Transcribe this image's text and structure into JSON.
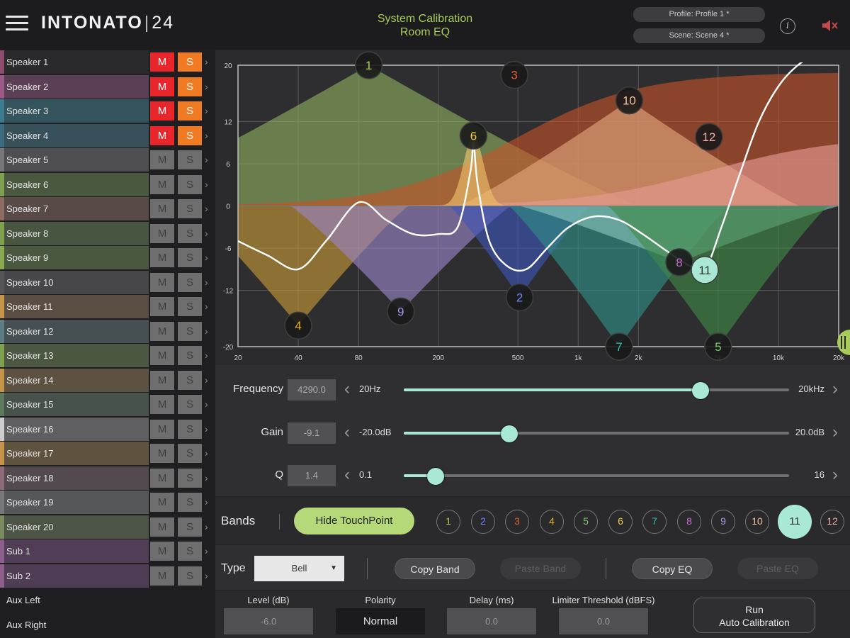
{
  "app": {
    "logo_main": "INTONATO",
    "logo_sep": "|",
    "logo_num": "24",
    "title_line1": "System Calibration",
    "title_line2": "Room EQ",
    "profile": "Profile: Profile 1 *",
    "scene": "Scene: Scene 4 *",
    "info_icon": "info-icon",
    "mute_icon": "speaker-muted-icon"
  },
  "sidebar": {
    "speakers": [
      {
        "label": "Speaker 1",
        "color": "#8b4f6d",
        "bg": "#2a2a2d",
        "m": "M",
        "s": "S",
        "mute_on": true,
        "solo_on": true
      },
      {
        "label": "Speaker 2",
        "color": "#9b5b86",
        "bg": "#5b3f55",
        "m": "M",
        "s": "S",
        "mute_on": true,
        "solo_on": true
      },
      {
        "label": "Speaker 3",
        "color": "#3c7c8e",
        "bg": "#35555e",
        "m": "M",
        "s": "S",
        "mute_on": true,
        "solo_on": true
      },
      {
        "label": "Speaker 4",
        "color": "#3c6c7e",
        "bg": "#37505a",
        "m": "M",
        "s": "S",
        "mute_on": true,
        "solo_on": true
      },
      {
        "label": "Speaker 5",
        "color": "#777777",
        "bg": "#4f4f52",
        "m": "M",
        "s": "S",
        "mute_on": false,
        "solo_on": false
      },
      {
        "label": "Speaker 6",
        "color": "#7ea04f",
        "bg": "#4a5840",
        "m": "M",
        "s": "S",
        "mute_on": false,
        "solo_on": false
      },
      {
        "label": "Speaker 7",
        "color": "#8c6a5f",
        "bg": "#574a47",
        "m": "M",
        "s": "S",
        "mute_on": false,
        "solo_on": false
      },
      {
        "label": "Speaker 8",
        "color": "#7ea04f",
        "bg": "#485540",
        "m": "M",
        "s": "S",
        "mute_on": false,
        "solo_on": false
      },
      {
        "label": "Speaker 9",
        "color": "#8aa84f",
        "bg": "#4b5840",
        "m": "M",
        "s": "S",
        "mute_on": false,
        "solo_on": false
      },
      {
        "label": "Speaker 10",
        "color": "#555555",
        "bg": "#474749",
        "m": "M",
        "s": "S",
        "mute_on": false,
        "solo_on": false
      },
      {
        "label": "Speaker 11",
        "color": "#c4944a",
        "bg": "#5a4e42",
        "m": "M",
        "s": "S",
        "mute_on": false,
        "solo_on": false
      },
      {
        "label": "Speaker 12",
        "color": "#5e7c86",
        "bg": "#464f52",
        "m": "M",
        "s": "S",
        "mute_on": false,
        "solo_on": false
      },
      {
        "label": "Speaker 13",
        "color": "#7ea04f",
        "bg": "#4b5741",
        "m": "M",
        "s": "S",
        "mute_on": false,
        "solo_on": false
      },
      {
        "label": "Speaker 14",
        "color": "#c4944a",
        "bg": "#5d5141",
        "m": "M",
        "s": "S",
        "mute_on": false,
        "solo_on": false
      },
      {
        "label": "Speaker 15",
        "color": "#5f7a5e",
        "bg": "#47524a",
        "m": "M",
        "s": "S",
        "mute_on": false,
        "solo_on": false
      },
      {
        "label": "Speaker 16",
        "color": "#cccccc",
        "bg": "#5f5f62",
        "m": "M",
        "s": "S",
        "mute_on": false,
        "solo_on": false
      },
      {
        "label": "Speaker 17",
        "color": "#c4944a",
        "bg": "#5f533f",
        "m": "M",
        "s": "S",
        "mute_on": false,
        "solo_on": false
      },
      {
        "label": "Speaker 18",
        "color": "#8c6a7a",
        "bg": "#524a4f",
        "m": "M",
        "s": "S",
        "mute_on": false,
        "solo_on": false
      },
      {
        "label": "Speaker 19",
        "color": "#777777",
        "bg": "#555759",
        "m": "M",
        "s": "S",
        "mute_on": false,
        "solo_on": false
      },
      {
        "label": "Speaker 20",
        "color": "#7a8c5f",
        "bg": "#4c5446",
        "m": "M",
        "s": "S",
        "mute_on": false,
        "solo_on": false
      },
      {
        "label": "Sub 1",
        "color": "#8c5f8a",
        "bg": "#513e56",
        "m": "M",
        "s": "S",
        "mute_on": false,
        "solo_on": false
      },
      {
        "label": "Sub 2",
        "color": "#8c5f8a",
        "bg": "#4f3d55",
        "m": "M",
        "s": "S",
        "mute_on": false,
        "solo_on": false
      }
    ],
    "aux": [
      {
        "label": "Aux Left"
      },
      {
        "label": "Aux Right"
      }
    ],
    "chevron": "›"
  },
  "chart_data": {
    "type": "line",
    "x_scale": "log",
    "xlim": [
      20,
      20000
    ],
    "ylim": [
      -20,
      20
    ],
    "grid": true,
    "y_ticks": [
      20,
      12,
      6,
      0,
      -6,
      -12,
      -20
    ],
    "x_ticks": [
      {
        "v": 20,
        "label": "20"
      },
      {
        "v": 40,
        "label": "40"
      },
      {
        "v": 80,
        "label": "80"
      },
      {
        "v": 200,
        "label": "200"
      },
      {
        "v": 500,
        "label": "500"
      },
      {
        "v": 1000,
        "label": "1k"
      },
      {
        "v": 2000,
        "label": "2k"
      },
      {
        "v": 5000,
        "label": "5k"
      },
      {
        "v": 10000,
        "label": "10k"
      },
      {
        "v": 20000,
        "label": "20k"
      }
    ],
    "bands": [
      {
        "id": "1",
        "color": "#8fb060",
        "text": "#a8cc5a",
        "kind": "peak",
        "freq": 90,
        "gain": 20,
        "width": 1.35
      },
      {
        "id": "3",
        "color": "#c5532a",
        "text": "#e06030",
        "kind": "shelf",
        "freq": 480,
        "gain": 19,
        "width": 1.25
      },
      {
        "id": "10",
        "color": "#e3a87d",
        "text": "#f0c39a",
        "kind": "peak",
        "freq": 1800,
        "gain": 15,
        "width": 0.85
      },
      {
        "id": "12",
        "color": "#e79b95",
        "text": "#f0b0a8",
        "kind": "shelf",
        "freq": 4500,
        "gain": 10,
        "width": 1.3
      },
      {
        "id": "6",
        "color": "#f0c46a",
        "text": "#f0c94a",
        "kind": "peak",
        "freq": 300,
        "gain": 10,
        "width": 0.1
      },
      {
        "id": "4",
        "color": "#c89a36",
        "text": "#e8b02a",
        "kind": "peak",
        "freq": 40,
        "gain": -17,
        "width": 0.55
      },
      {
        "id": "9",
        "color": "#9b86c8",
        "text": "#a496e0",
        "kind": "peak",
        "freq": 130,
        "gain": -15,
        "width": 0.55
      },
      {
        "id": "2",
        "color": "#3d55b8",
        "text": "#6a86ff",
        "kind": "peak",
        "freq": 510,
        "gain": -13,
        "width": 0.35
      },
      {
        "id": "7",
        "color": "#2e8f88",
        "text": "#2ec4b4",
        "kind": "peak",
        "freq": 1600,
        "gain": -20,
        "width": 0.55
      },
      {
        "id": "8",
        "color": "#8ac8bd",
        "text": "#c86ad0",
        "kind": "peak",
        "freq": 3200,
        "gain": -8,
        "width": 0.8
      },
      {
        "id": "5",
        "color": "#3f8a45",
        "text": "#7ec86a",
        "kind": "peak",
        "freq": 5000,
        "gain": -20,
        "width": 0.55
      },
      {
        "id": "11",
        "color": "#a9e8d5",
        "text": "#333333",
        "kind": "marker",
        "freq": 4290,
        "gain": -9.1,
        "width": 0
      }
    ],
    "response_curve": {
      "color": "#ffffff",
      "x": [
        20,
        28,
        40,
        55,
        80,
        110,
        150,
        200,
        250,
        290,
        300,
        315,
        360,
        440,
        550,
        700,
        900,
        1200,
        1600,
        2100,
        2800,
        3600,
        4290,
        5200,
        6500,
        8000,
        10000,
        12500,
        16000,
        20000
      ],
      "y": [
        -5,
        -7,
        -9,
        -5,
        0.5,
        -2,
        -4,
        -4,
        -3,
        5,
        9,
        3,
        -5,
        -8.5,
        -9,
        -6,
        -3,
        -1.5,
        -2,
        -4,
        -6.5,
        -8.5,
        -9.1,
        -3,
        5,
        12,
        17,
        20,
        22,
        25
      ]
    }
  },
  "params": {
    "frequency": {
      "label": "Frequency",
      "value": "4290.0",
      "min": "20Hz",
      "max": "20kHz",
      "fraction": 0.77
    },
    "gain": {
      "label": "Gain",
      "value": "-9.1",
      "min": "-20.0dB",
      "max": "20.0dB",
      "fraction": 0.273
    },
    "q": {
      "label": "Q",
      "value": "1.4",
      "min": "0.1",
      "max": "16",
      "fraction": 0.083
    },
    "left_arrow": "‹",
    "right_arrow": "›"
  },
  "bands_bar": {
    "label": "Bands",
    "hide_btn": "Hide TouchPoint",
    "buttons": [
      {
        "label": "1",
        "color": "#a8cc5a"
      },
      {
        "label": "2",
        "color": "#6a86ff"
      },
      {
        "label": "3",
        "color": "#e06030"
      },
      {
        "label": "4",
        "color": "#e8b02a"
      },
      {
        "label": "5",
        "color": "#7ec86a"
      },
      {
        "label": "6",
        "color": "#f0c94a"
      },
      {
        "label": "7",
        "color": "#2ec4b4"
      },
      {
        "label": "8",
        "color": "#c86ad0"
      },
      {
        "label": "9",
        "color": "#a496e0"
      },
      {
        "label": "10",
        "color": "#f0c39a"
      },
      {
        "label": "11",
        "color": "#333333",
        "selected": true
      },
      {
        "label": "12",
        "color": "#f0b0a8"
      }
    ]
  },
  "type_row": {
    "label": "Type",
    "type_value": "Bell",
    "caret": "▼",
    "copy_band": "Copy Band",
    "paste_band": "Paste Band",
    "copy_eq": "Copy EQ",
    "paste_eq": "Paste EQ"
  },
  "bottom": {
    "level_label": "Level (dB)",
    "level_value": "-6.0",
    "polarity_label": "Polarity",
    "polarity_value": "Normal",
    "delay_label": "Delay (ms)",
    "delay_value": "0.0",
    "limiter_label": "Limiter Threshold (dBFS)",
    "limiter_value": "0.0",
    "run_line1": "Run",
    "run_line2": "Auto Calibration"
  }
}
